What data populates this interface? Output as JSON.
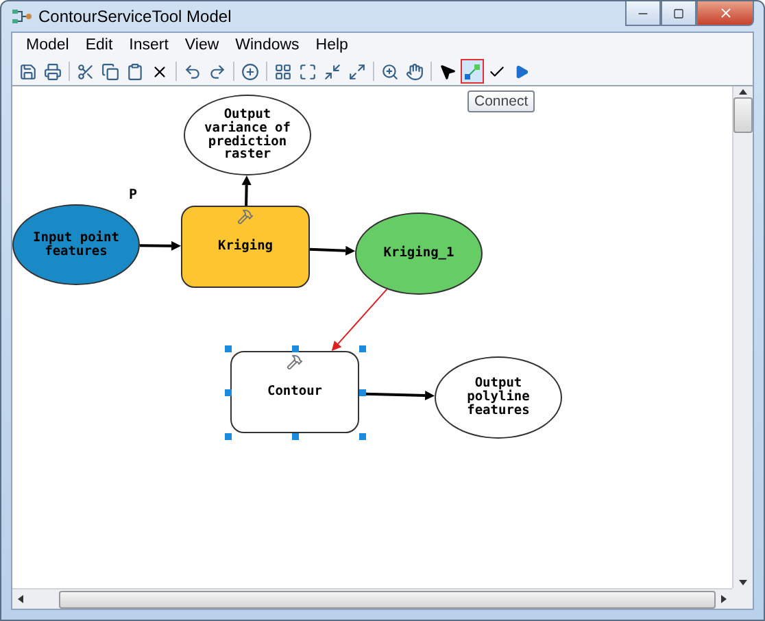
{
  "window": {
    "title": "ContourServiceTool Model"
  },
  "menu": [
    "Model",
    "Edit",
    "Insert",
    "View",
    "Windows",
    "Help"
  ],
  "tools": [
    {
      "selected": false
    },
    {
      "selected": true
    }
  ],
  "tooltip": "Connect",
  "diagram": {
    "label": "P",
    "nodes": [
      {
        "kind": "ellipse",
        "text": "Input point features",
        "color": "#1a8ac6",
        "selected": false
      },
      {
        "kind": "tool",
        "text": "Kriging",
        "color": "#fdc631",
        "selected": false
      },
      {
        "kind": "ellipse",
        "text": "Output variance of prediction raster",
        "color": "#ffffff",
        "selected": false
      },
      {
        "kind": "ellipse",
        "text": "Kriging_1",
        "color": "#66cc66",
        "selected": false
      },
      {
        "kind": "tool",
        "text": "Contour",
        "color": "#ffffff",
        "selected": true
      },
      {
        "kind": "ellipse",
        "text": "Output polyline features",
        "color": "#ffffff",
        "selected": false
      }
    ],
    "connectors": [
      {
        "color": "#000000"
      },
      {
        "color": "#000000"
      },
      {
        "color": "#000000"
      },
      {
        "color": "#e02020"
      },
      {
        "color": "#000000"
      }
    ]
  }
}
